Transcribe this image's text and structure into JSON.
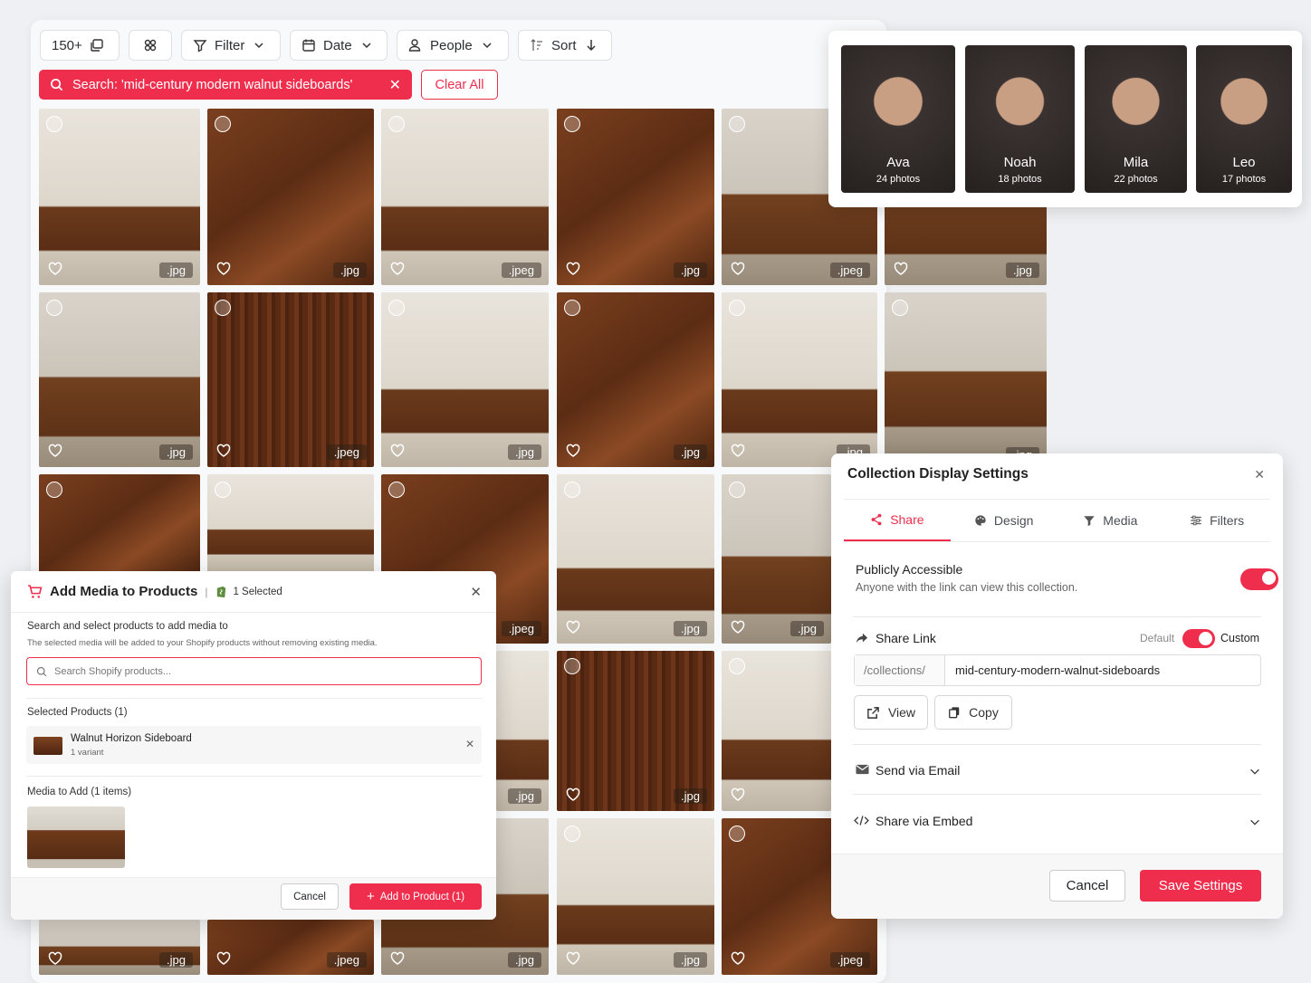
{
  "toolbar": {
    "count_label": "150+",
    "filter_label": "Filter",
    "date_label": "Date",
    "people_label": "People",
    "sort_label": "Sort"
  },
  "search": {
    "query_label": "Search: 'mid-century modern walnut sideboards'",
    "clear_all": "Clear All"
  },
  "gallery": {
    "extensions": {
      "r1": [
        ".jpg",
        ".jpg",
        ".jpeg",
        ".jpg",
        ".jpeg",
        ".jpg"
      ],
      "r2": [
        ".jpg",
        ".jpeg",
        ".jpg",
        ".jpg",
        ".jpg",
        ".jpg"
      ],
      "r3": [
        ".jpeg",
        ".jpg",
        ".jpg"
      ],
      "r4": [
        ".jpg",
        ".jpg"
      ],
      "r5": [
        ".jpg",
        ".jpeg",
        ".jpg",
        ".jpg",
        ".jpeg"
      ]
    }
  },
  "people": [
    {
      "name": "Ava",
      "count": "24 photos"
    },
    {
      "name": "Noah",
      "count": "18 photos"
    },
    {
      "name": "Mila",
      "count": "22 photos"
    },
    {
      "name": "Leo",
      "count": "17 photos"
    }
  ],
  "add_media": {
    "title": "Add Media to Products",
    "selected_badge": "1 Selected",
    "search_heading": "Search and select products to add media to",
    "search_sub": "The selected media will be added to your Shopify products without removing existing media.",
    "search_placeholder": "Search Shopify products...",
    "selected_products_label": "Selected Products (1)",
    "product_name": "Walnut Horizon Sideboard",
    "product_variant": "1 variant",
    "media_label": "Media to Add (1 items)",
    "cancel": "Cancel",
    "add_button": "Add to Product (1)"
  },
  "settings": {
    "title": "Collection Display Settings",
    "tabs": [
      "Share",
      "Design",
      "Media",
      "Filters"
    ],
    "public_title": "Publicly Accessible",
    "public_sub": "Anyone with the link can view this collection.",
    "share_link_title": "Share Link",
    "default_label": "Default",
    "custom_label": "Custom",
    "link_prefix": "/collections/",
    "link_slug": "mid-century-modern-walnut-sideboards",
    "view_label": "View",
    "copy_label": "Copy",
    "email_label": "Send via Email",
    "embed_label": "Share via Embed",
    "cancel": "Cancel",
    "save": "Save Settings"
  },
  "colors": {
    "accent": "#ef2e4d"
  }
}
